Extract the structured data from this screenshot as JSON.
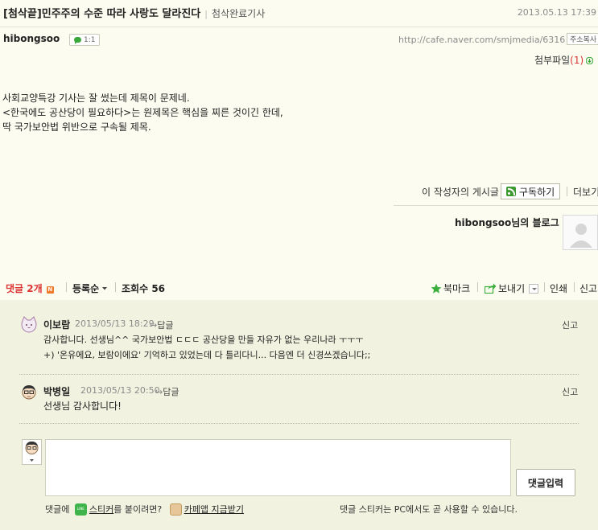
{
  "post": {
    "title": "[첨삭끝]민주주의 수준 따라 사랑도 달라진다",
    "category": "첨삭완료기사",
    "date": "2013.05.13 17:39",
    "author": "hibongsoo",
    "comment_badge": "1:1",
    "url": "http://cafe.naver.com/smjmedia/6316",
    "copy_label": "주소복사",
    "attachment_label": "첨부파일",
    "attachment_count": "(1)",
    "body_lines": [
      "사회교양특강 기사는 잘 썼는데 제목이 문제네.",
      "<한국에도 공산당이 필요하다>는 원제목은 핵심을 찌른 것이긴 한데,",
      "딱 국가보안법 위반으로 구속될 제목."
    ]
  },
  "author_bar": {
    "posts_label": "이 작성자의 게시글",
    "subscribe_label": "구독하기",
    "more_label": "더보기",
    "blog_name": "hibongsoo님의 블로그"
  },
  "comments_header": {
    "count_label": "댓글 2개",
    "new_badge": "N",
    "sort_label": "등록순",
    "views_label": "조회수",
    "views_value": "56",
    "bookmark_label": "북마크",
    "share_label": "보내기",
    "print_label": "인쇄",
    "report_label": "신고"
  },
  "comments": [
    {
      "author": "이보람",
      "date": "2013/05/13 18:29",
      "reply_label": "답글",
      "report_label": "신고",
      "lines": [
        "감사합니다. 선생님^^ 국가보안법 ㄷㄷㄷ 공산당을 만들 자유가 없는 우리나라 ㅜㅜㅜ",
        "+) '온유에요, 보람이에요' 기억하고 있었는데 다 틀리다니... 다음엔 더 신경쓰겠습니다;;"
      ]
    },
    {
      "author": "박병일",
      "date": "2013/05/13 20:50",
      "reply_label": "답글",
      "report_label": "신고",
      "lines": [
        "선생님 감사합니다!"
      ]
    }
  ],
  "write": {
    "input_value": "",
    "submit_label": "댓글입력",
    "sticker_prefix": "댓글에",
    "sticker_link": "스티커",
    "sticker_suffix": "를 붙이려면?",
    "app_link": "카페앱 지금받기",
    "notice": "댓글 스티커는 PC에서도 곧 사용할 수 있습니다."
  },
  "colors": {
    "background": "#fcfcf0",
    "comment_area": "#f2f2e0",
    "accent_red": "#dd3333",
    "green": "#3d9a32"
  }
}
